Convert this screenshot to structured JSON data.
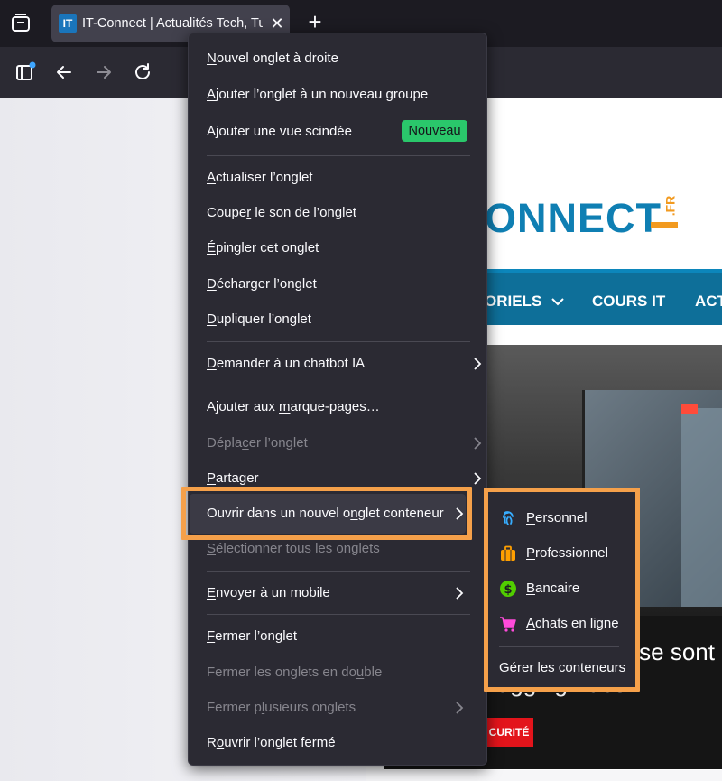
{
  "browser": {
    "tab_title": "IT-Connect | Actualités Tech, Tut",
    "tab_favicon_text": "IT",
    "new_tab_symbol": "+",
    "close_tab_symbol": "✕",
    "icons": [
      "tab-groups-icon",
      "sidebar-icon",
      "back-arrow-icon",
      "forward-arrow-icon",
      "reload-icon",
      "close-icon",
      "plus-icon"
    ]
  },
  "page": {
    "logo_text": "ONNECT",
    "logo_suffix": ".FR",
    "nav_items": [
      "ORIELS",
      "COURS IT",
      "ACT"
    ],
    "headline_line1": "A se sont",
    "headline_line2": "lugging Face",
    "category_badge": "CURITÉ"
  },
  "context_menu": {
    "items": [
      {
        "pre": "",
        "u": "N",
        "post": "ouvel onglet à droite"
      },
      {
        "pre": "",
        "u": "A",
        "post": "jouter l’onglet à un nouveau groupe"
      },
      {
        "pre": "A",
        "u": "j",
        "post": "outer une vue scindée"
      },
      {
        "pre": "",
        "u": "A",
        "post": "ctualiser l’onglet"
      },
      {
        "pre": "Coupe",
        "u": "r",
        "post": " le son de l’onglet"
      },
      {
        "pre": "",
        "u": "É",
        "post": "pingler cet onglet"
      },
      {
        "pre": "",
        "u": "D",
        "post": "écharger l’onglet"
      },
      {
        "pre": "",
        "u": "D",
        "post": "upliquer l’onglet"
      },
      {
        "pre": "",
        "u": "D",
        "post": "emander à un chatbot IA"
      },
      {
        "pre": "Ajouter aux ",
        "u": "m",
        "post": "arque-pages…"
      },
      {
        "pre": "Dépla",
        "u": "c",
        "post": "er l’onglet"
      },
      {
        "pre": "",
        "u": "P",
        "post": "artager"
      },
      {
        "pre": "Ouvrir dans un nouvel o",
        "u": "n",
        "post": "glet conteneur"
      },
      {
        "pre": "",
        "u": "S",
        "post": "électionner tous les onglets"
      },
      {
        "pre": "",
        "u": "E",
        "post": "nvoyer à un mobile"
      },
      {
        "pre": "",
        "u": "F",
        "post": "ermer l’onglet"
      },
      {
        "pre": "Fermer les onglets en do",
        "u": "u",
        "post": "ble"
      },
      {
        "pre": "Fermer p",
        "u": "l",
        "post": "usieurs onglets"
      },
      {
        "pre": "R",
        "u": "o",
        "post": "uvrir l’onglet fermé"
      }
    ],
    "new_badge": "Nouveau"
  },
  "container_submenu": {
    "items": [
      {
        "pre": "",
        "u": "P",
        "post": "ersonnel",
        "icon": "fingerprint-icon",
        "color": "#37adff"
      },
      {
        "pre": "",
        "u": "P",
        "post": "rofessionnel",
        "icon": "briefcase-icon",
        "color": "#ff9f00"
      },
      {
        "pre": "",
        "u": "B",
        "post": "ancaire",
        "icon": "dollar-icon",
        "color": "#51cd00"
      },
      {
        "pre": "",
        "u": "A",
        "post": "chats en ligne",
        "icon": "cart-icon",
        "color": "#ff4bda"
      }
    ],
    "manage": {
      "pre": "Gérer les co",
      "u": "n",
      "post": "teneurs"
    }
  },
  "colors": {
    "highlight_outline": "#f5a04a",
    "menu_bg": "#2b2a33",
    "new_badge": "#2ac76b"
  }
}
